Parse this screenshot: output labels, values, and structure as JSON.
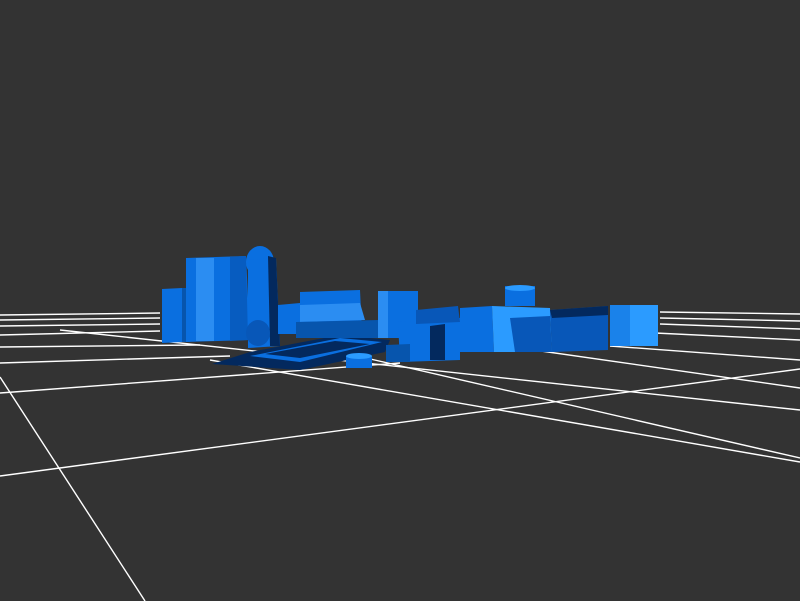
{
  "viewer": {
    "background_color": "#333333",
    "grid_color": "#ffffff",
    "model_color_base": "#0a6fe0",
    "model_color_light": "#2b9bff",
    "model_color_mid": "#0857b8",
    "model_color_dark": "#03295e"
  }
}
